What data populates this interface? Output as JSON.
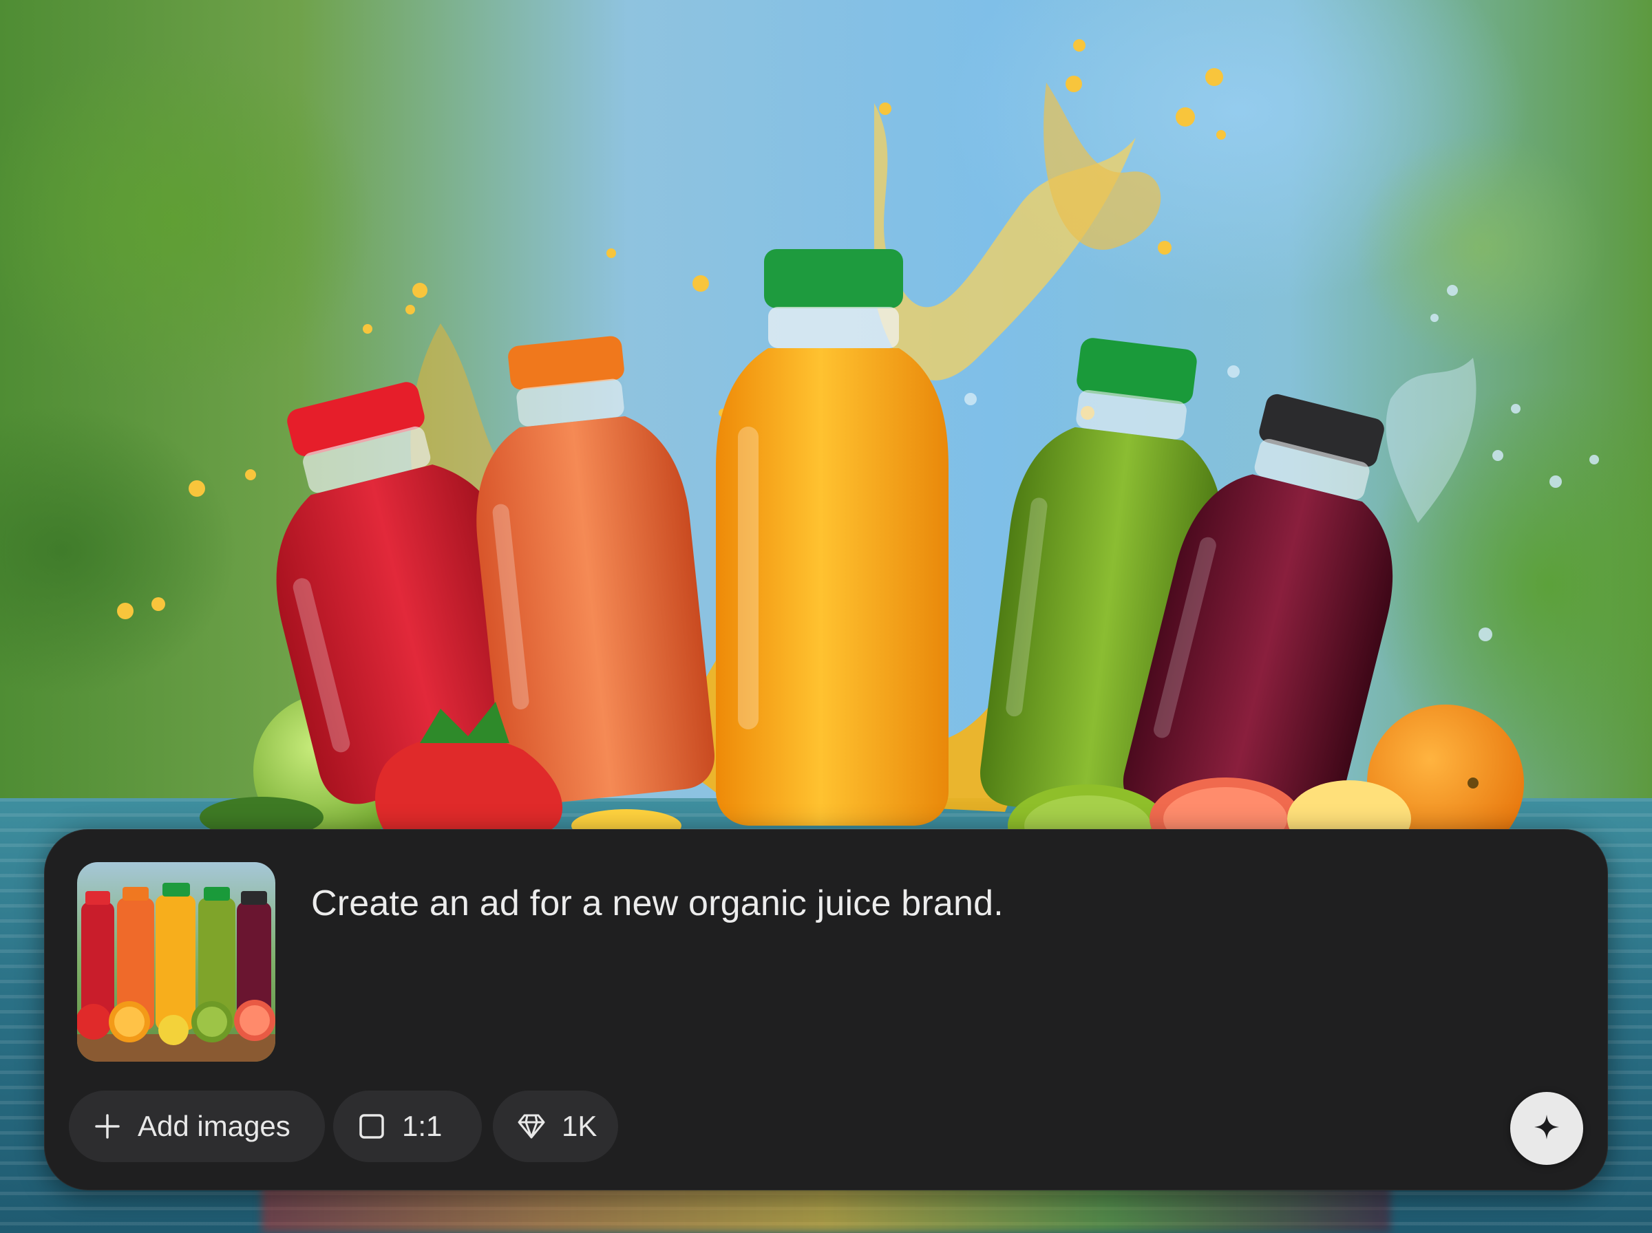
{
  "prompt": {
    "text": "Create an ad for a new organic juice brand.",
    "attached_image": {
      "description_icon": "juice-bottles-thumbnail"
    }
  },
  "toolbar": {
    "add_images": {
      "label": "Add images",
      "icon": "plus-icon"
    },
    "aspect_ratio": {
      "label": "1:1",
      "icon": "square-icon"
    },
    "resolution": {
      "label": "1K",
      "icon": "diamond-icon"
    },
    "submit": {
      "icon": "sparkle-icon"
    }
  },
  "colors": {
    "panel": "#1f1f20",
    "chip": "#2d2d2f",
    "submit_button": "#e9e9e9",
    "text": "#ececec"
  }
}
